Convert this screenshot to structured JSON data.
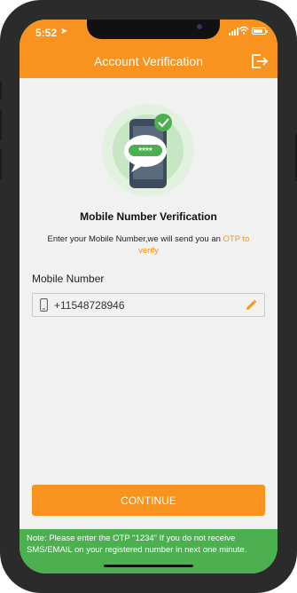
{
  "status_bar": {
    "time": "5:52",
    "location_glyph": "➤"
  },
  "app_bar": {
    "title": "Account Verification",
    "exit_icon": "logout-icon"
  },
  "illustration": {
    "otp_mask": "****",
    "check_icon": "checkmark-icon"
  },
  "verification": {
    "heading": "Mobile Number Verification",
    "description_prefix": "Enter your Mobile Number,we will send you an ",
    "description_otp": "OTP",
    "description_suffix": " to verify"
  },
  "form": {
    "label": "Mobile Number",
    "phone_value": "+11548728946",
    "phone_icon": "phone-icon",
    "edit_icon": "pencil-icon"
  },
  "actions": {
    "continue_label": "CONTINUE"
  },
  "note": "Note: Please enter the OTP \"1234\" If you do not receive SMS/EMAIL on your registered number in next one minute.",
  "colors": {
    "accent": "#f7931e",
    "note_bg": "#4caf50",
    "screen_bg": "#f1f1f1"
  }
}
